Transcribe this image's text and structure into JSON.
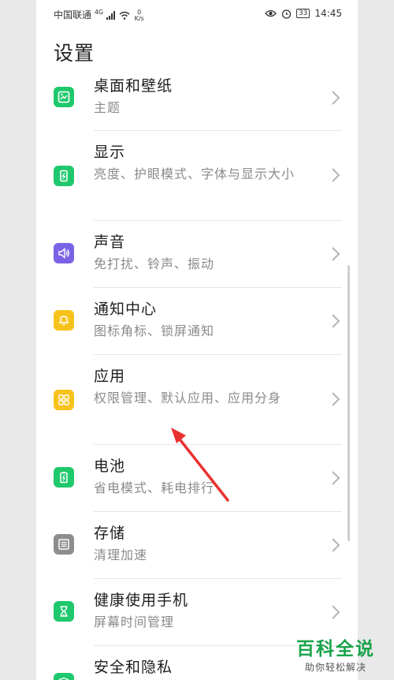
{
  "status_bar": {
    "carrier": "中国联通",
    "network": "4G",
    "speed_value": "0",
    "speed_unit": "K/s",
    "battery": "33",
    "time": "14:45"
  },
  "page_title": "设置",
  "settings": [
    {
      "title": "桌面和壁纸",
      "subtitle": "主题",
      "icon": "wallpaper-icon",
      "color": "#1fc86c"
    },
    {
      "title": "显示",
      "subtitle": "亮度、护眼模式、字体与显示大小",
      "icon": "display-icon",
      "color": "#1fc86c"
    },
    {
      "title": "声音",
      "subtitle": "免打扰、铃声、振动",
      "icon": "sound-icon",
      "color": "#7b63e6"
    },
    {
      "title": "通知中心",
      "subtitle": "图标角标、锁屏通知",
      "icon": "bell-icon",
      "color": "#f7c21b"
    },
    {
      "title": "应用",
      "subtitle": "权限管理、默认应用、应用分身",
      "icon": "apps-grid-icon",
      "color": "#f7c21b"
    },
    {
      "title": "电池",
      "subtitle": "省电模式、耗电排行",
      "icon": "battery-icon",
      "color": "#1fc86c"
    },
    {
      "title": "存储",
      "subtitle": "清理加速",
      "icon": "storage-icon",
      "color": "#8d8d8d"
    },
    {
      "title": "健康使用手机",
      "subtitle": "屏幕时间管理",
      "icon": "hourglass-icon",
      "color": "#1fc86c"
    },
    {
      "title": "安全和隐私",
      "subtitle": "",
      "icon": "shield-icon",
      "color": "#1fc86c"
    }
  ],
  "watermark": {
    "title": "百科全说",
    "subtitle": "助你轻松解决"
  },
  "annotation_color": "#e8312f"
}
